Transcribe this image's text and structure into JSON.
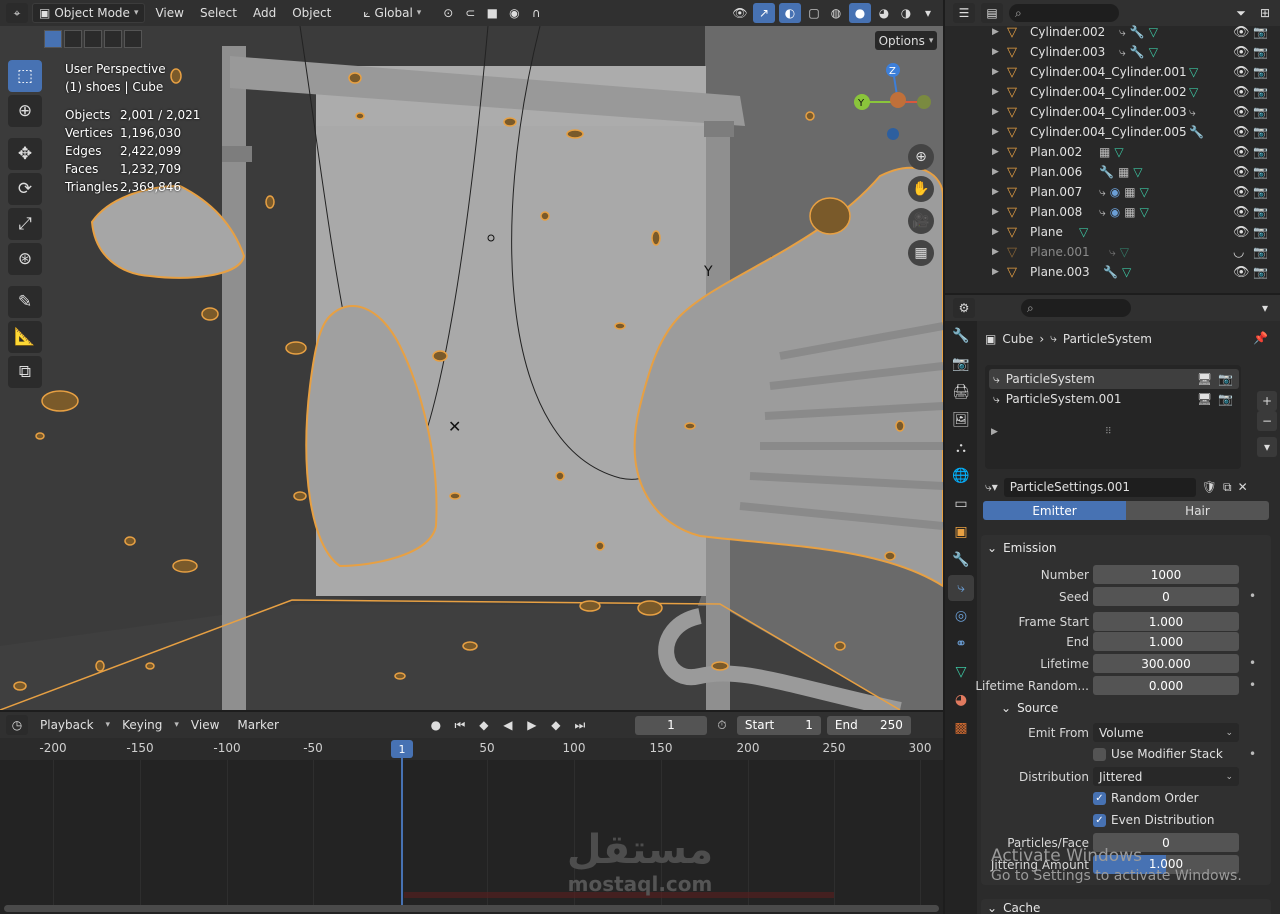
{
  "viewport": {
    "mode_label": "Object Mode",
    "menus": [
      "View",
      "Select",
      "Add",
      "Object"
    ],
    "orientation_label": "Global",
    "options_label": "Options",
    "perspective": "User Perspective",
    "collection": "(1) shoes | Cube",
    "stats": [
      {
        "key": "Objects",
        "value": "2,001 / 2,021"
      },
      {
        "key": "Vertices",
        "value": "1,196,030"
      },
      {
        "key": "Edges",
        "value": "2,422,099"
      },
      {
        "key": "Faces",
        "value": "1,232,709"
      },
      {
        "key": "Triangles",
        "value": "2,369,846"
      }
    ],
    "gizmo": {
      "z": "Z",
      "y": "Y"
    },
    "tools": [
      "select-box",
      "cursor",
      "move",
      "rotate",
      "scale",
      "transform",
      "annotate",
      "measure",
      "add-cube"
    ]
  },
  "timeline": {
    "menus": [
      "Playback",
      "Keying",
      "View",
      "Marker"
    ],
    "current_frame": "1",
    "start_label": "Start",
    "start_value": "1",
    "end_label": "End",
    "end_value": "250",
    "ruler": [
      "-200",
      "-150",
      "-100",
      "-50",
      "50",
      "100",
      "150",
      "200",
      "250",
      "300"
    ],
    "playhead": "1"
  },
  "watermark": {
    "arabic": "مستقل",
    "latin": "mostaql.com"
  },
  "windows_activation": {
    "line1": "Activate Windows",
    "line2": "Go to Settings to activate Windows."
  },
  "outliner": {
    "rows": [
      {
        "name": "Cylinder.002",
        "dim": false
      },
      {
        "name": "Cylinder.003",
        "dim": false
      },
      {
        "name": "Cylinder.004_Cylinder.001",
        "dim": false
      },
      {
        "name": "Cylinder.004_Cylinder.002",
        "dim": false
      },
      {
        "name": "Cylinder.004_Cylinder.003",
        "dim": false
      },
      {
        "name": "Cylinder.004_Cylinder.005",
        "dim": false
      },
      {
        "name": "Plan.002",
        "dim": false
      },
      {
        "name": "Plan.006",
        "dim": false
      },
      {
        "name": "Plan.007",
        "dim": false
      },
      {
        "name": "Plan.008",
        "dim": false
      },
      {
        "name": "Plane",
        "dim": false
      },
      {
        "name": "Plane.001",
        "dim": true
      },
      {
        "name": "Plane.003",
        "dim": false
      }
    ]
  },
  "properties": {
    "breadcrumb": {
      "object": "Cube",
      "system": "ParticleSystem"
    },
    "systems": [
      "ParticleSystem",
      "ParticleSystem.001"
    ],
    "settings_name": "ParticleSettings.001",
    "type_tabs": [
      "Emitter",
      "Hair"
    ],
    "emission": {
      "title": "Emission",
      "number_label": "Number",
      "number": "1000",
      "seed_label": "Seed",
      "seed": "0",
      "frame_start_label": "Frame Start",
      "frame_start": "1.000",
      "end_label": "End",
      "end": "1.000",
      "lifetime_label": "Lifetime",
      "lifetime": "300.000",
      "lifetime_random_label": "Lifetime Random...",
      "lifetime_random": "0.000"
    },
    "source": {
      "title": "Source",
      "emit_from_label": "Emit From",
      "emit_from": "Volume",
      "use_modifier_stack": "Use Modifier Stack",
      "distribution_label": "Distribution",
      "distribution": "Jittered",
      "random_order": "Random Order",
      "even_distribution": "Even Distribution",
      "particles_face_label": "Particles/Face",
      "particles_face": "0",
      "jittering_label": "Jittering Amount",
      "jittering": "1.000",
      "jittering_fraction": 0.5
    },
    "cache_title": "Cache"
  },
  "colors": {
    "accent": "#4772b3",
    "selection": "#e7a043"
  }
}
